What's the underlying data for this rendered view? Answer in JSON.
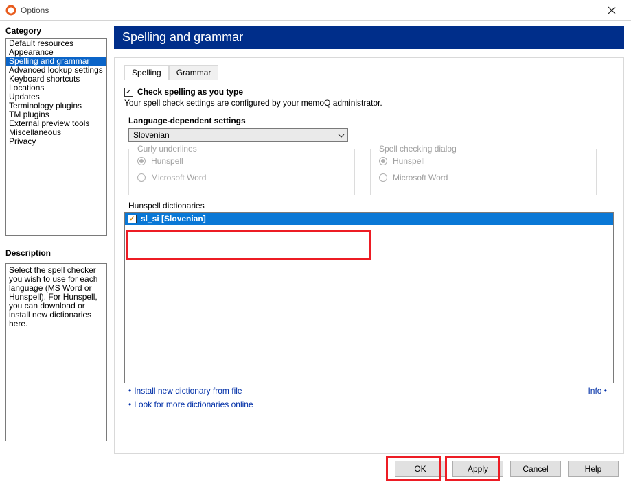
{
  "window": {
    "title": "Options"
  },
  "sidebar": {
    "category_label": "Category",
    "items": [
      "Default resources",
      "Appearance",
      "Spelling and grammar",
      "Advanced lookup settings",
      "Keyboard shortcuts",
      "Locations",
      "Updates",
      "Terminology plugins",
      "TM plugins",
      "External preview tools",
      "Miscellaneous",
      "Privacy"
    ],
    "selected_index": 2,
    "description_label": "Description",
    "description_text": "Select the spell checker you wish to use for each language (MS Word or Hunspell). For Hunspell, you can download or install new dictionaries here."
  },
  "page": {
    "title": "Spelling and grammar",
    "tabs": [
      {
        "label": "Spelling",
        "active": true
      },
      {
        "label": "Grammar",
        "active": false
      }
    ],
    "check_spelling_label": "Check spelling as you type",
    "check_spelling_checked": true,
    "admin_note": "Your spell check settings are configured by your memoQ administrator.",
    "lang_settings_label": "Language-dependent settings",
    "language_selected": "Slovenian",
    "curly_group": "Curly underlines",
    "dialog_group": "Spell checking dialog",
    "radio_hunspell": "Hunspell",
    "radio_msword": "Microsoft Word",
    "hunspell_dict_label": "Hunspell dictionaries",
    "dict_items": [
      {
        "label": "sl_si [Slovenian]",
        "checked": true,
        "selected": true
      }
    ],
    "link_install": "Install new dictionary from file",
    "link_more": "Look for more dictionaries online",
    "link_info": "Info"
  },
  "buttons": {
    "ok": "OK",
    "apply": "Apply",
    "cancel": "Cancel",
    "help": "Help"
  }
}
